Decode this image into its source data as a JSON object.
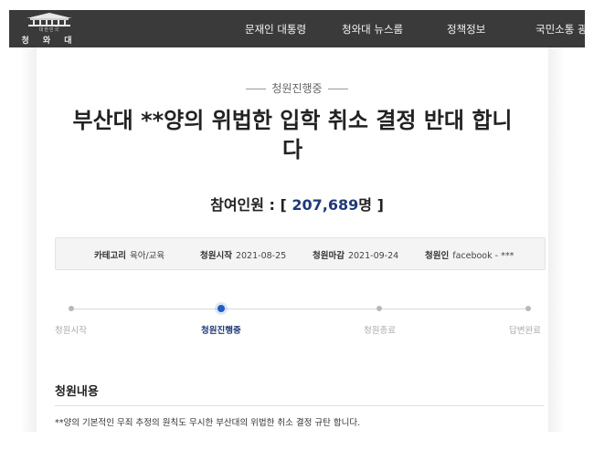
{
  "header": {
    "logo_small_text": "대한민국",
    "logo_name": "청 와 대",
    "nav": [
      "문재인 대통령",
      "청와대 뉴스룸",
      "정책정보",
      "국민소통 광"
    ]
  },
  "petition": {
    "status": "청원진행중",
    "title": "부산대 **양의 위법한 입학 취소 결정 반대 합니다",
    "count_label": "참여인원 : [ ",
    "count_value": "207,689",
    "count_suffix": "명 ]",
    "info": {
      "category_label": "카테고리",
      "category_value": "육아/교육",
      "start_label": "청원시작",
      "start_value": "2021-08-25",
      "end_label": "청원마감",
      "end_value": "2021-09-24",
      "author_label": "청원인",
      "author_value": "facebook - ***"
    },
    "steps": [
      {
        "label": "청원시작",
        "active": false
      },
      {
        "label": "청원진행중",
        "active": true
      },
      {
        "label": "청원종료",
        "active": false
      },
      {
        "label": "답변완료",
        "active": false
      }
    ],
    "content_title": "청원내용",
    "content_text": "**양의 기본적인 무죄 추정의 원칙도 무시한 부산대의 위법한 취소 결정 규탄 합니다."
  },
  "colors": {
    "header_bg": "#3a3a3a",
    "accent_blue": "#1f3a7a",
    "active_dot": "#1f5fbf"
  }
}
